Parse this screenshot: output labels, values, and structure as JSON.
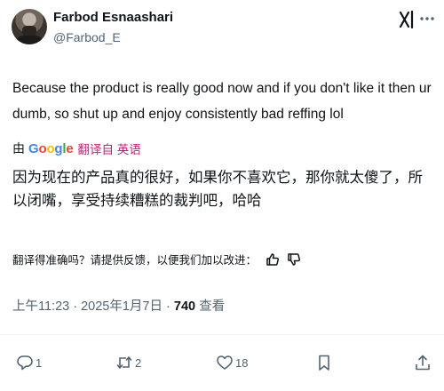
{
  "author": {
    "name": "Farbod Esnaashari",
    "handle": "@Farbod_E"
  },
  "tweet": {
    "text": "Because the product is really good now and if you don't like it then ur dumb, so shut up and enjoy consistently bad reffing lol"
  },
  "translation": {
    "by_prefix": "由",
    "provider": "Google",
    "link_label": "翻译自 英语",
    "text": "因为现在的产品真的很好，如果你不喜欢它，那你就太傻了，所以闭嘴，享受持续糟糕的裁判吧，哈哈",
    "feedback_prompt": "翻译得准确吗？请提供反馈，以便我们加以改进："
  },
  "meta": {
    "time": "上午11:23",
    "date": "2025年1月7日",
    "views_count": "740",
    "views_label": "查看"
  },
  "actions": {
    "replies": "1",
    "reposts": "2",
    "likes": "18"
  },
  "icons": {
    "grok": "grok-icon",
    "more": "more-options-icon",
    "reply": "reply-icon",
    "repost": "repost-icon",
    "like": "heart-icon",
    "bookmark": "bookmark-icon",
    "share": "share-icon",
    "thumbs_up": "thumbs-up-icon",
    "thumbs_down": "thumbs-down-icon"
  },
  "colors": {
    "text": "#0f1419",
    "secondary": "#536471",
    "translate_link": "#cc1f7a"
  }
}
